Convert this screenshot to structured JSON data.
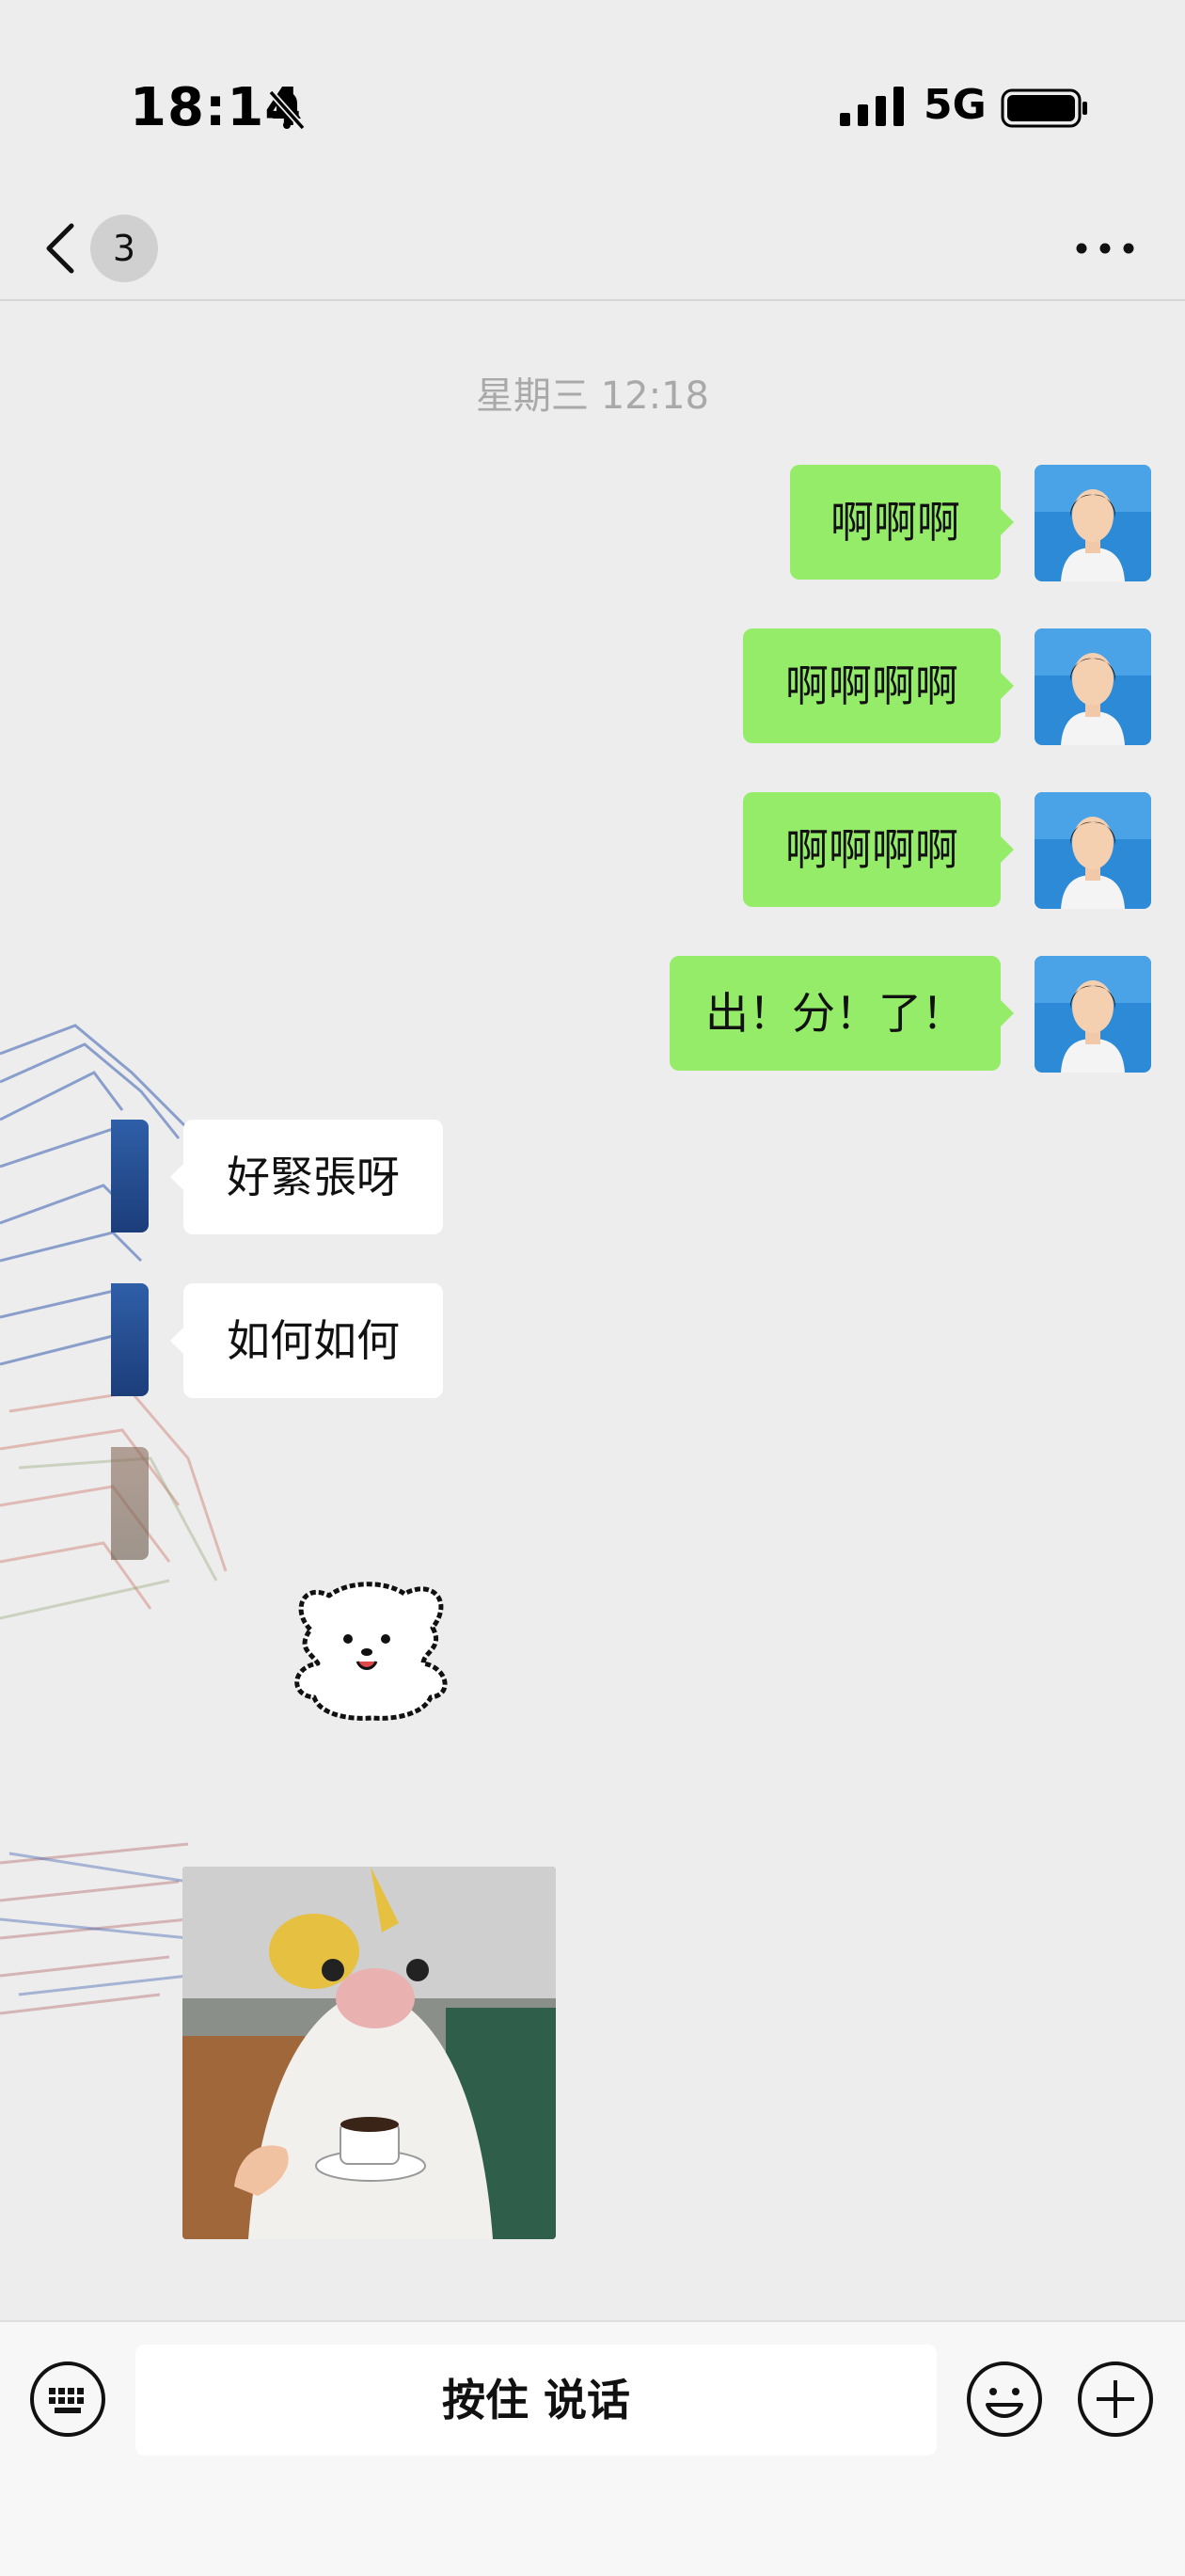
{
  "status_bar": {
    "time": "18:14",
    "network": "5G",
    "icons": [
      "bell-slash-icon",
      "signal-icon",
      "battery-icon"
    ]
  },
  "nav": {
    "unread_count": "3",
    "icons": [
      "chevron-left-icon",
      "more-dots-icon"
    ]
  },
  "timestamp": "星期三 12:18",
  "messages": [
    {
      "side": "out",
      "text": "啊啊啊"
    },
    {
      "side": "out",
      "text": "啊啊啊啊"
    },
    {
      "side": "out",
      "text": "啊啊啊啊"
    },
    {
      "side": "out",
      "text": "出！分！了！"
    },
    {
      "side": "in",
      "text": "好緊張呀"
    },
    {
      "side": "in",
      "text": "如何如何"
    },
    {
      "side": "in",
      "type": "sticker",
      "sticker": "white-dog-sticker"
    },
    {
      "side": "in",
      "type": "sticker",
      "sticker": "cat-with-coffee-sticker"
    }
  ],
  "input_bar": {
    "hold_to_talk": "按住 说话",
    "icons": [
      "keyboard-icon",
      "smile-emoji-icon",
      "plus-circle-icon"
    ]
  },
  "colors": {
    "outgoing_bubble": "#95ec69",
    "incoming_bubble": "#ffffff",
    "background": "#ededed"
  }
}
